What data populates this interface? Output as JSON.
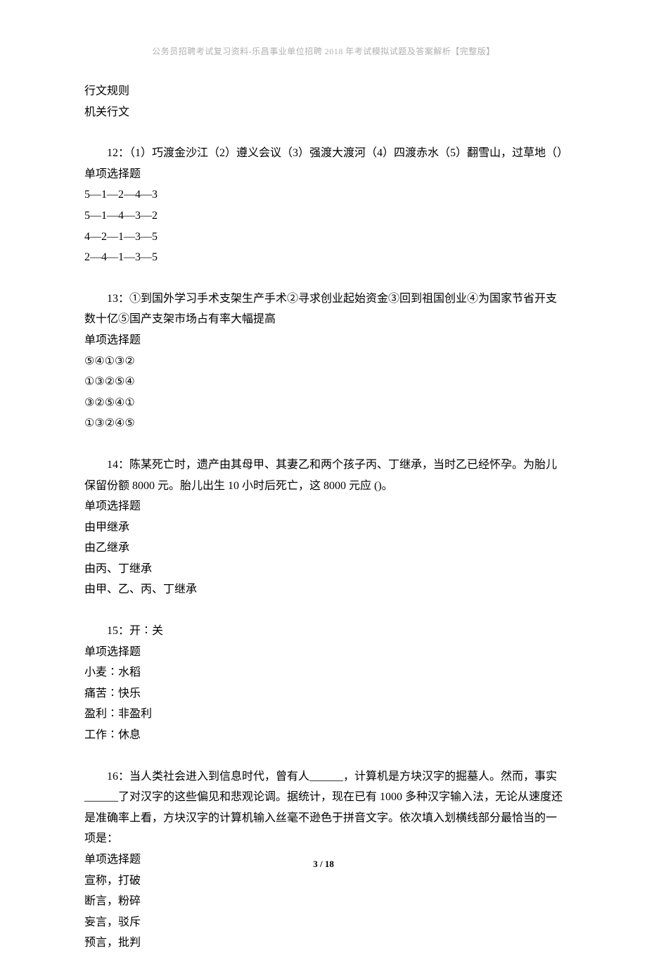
{
  "header": {
    "text": "公务员招聘考试复习资料-乐昌事业单位招聘 2018 年考试模拟试题及答案解析【完整版】"
  },
  "continuation": {
    "line1": "行文规则",
    "line2": "机关行文"
  },
  "q12": {
    "stem": "12：（1）巧渡金沙江（2）遵义会议（3）强渡大渡河（4）四渡赤水（5）翻雪山，过草地（）",
    "type": "单项选择题",
    "optA": "5—1—2—4—3",
    "optB": "5—1—4—3—2",
    "optC": "4—2—1—3—5",
    "optD": "2—4—1—3—5"
  },
  "q13": {
    "stem": "13：①到国外学习手术支架生产手术②寻求创业起始资金③回到祖国创业④为国家节省开支数十亿⑤国产支架市场占有率大幅提高",
    "type": "单项选择题",
    "optA": "⑤④①③②",
    "optB": "①③②⑤④",
    "optC": "③②⑤④①",
    "optD": "①③②④⑤"
  },
  "q14": {
    "stem": "14：陈某死亡时，遗产由其母甲、其妻乙和两个孩子丙、丁继承，当时乙已经怀孕。为胎儿保留份额 8000 元。胎儿出生 10 小时后死亡，这 8000 元应 ()。",
    "type": "单项选择题",
    "optA": "由甲继承",
    "optB": "由乙继承",
    "optC": "由丙、丁继承",
    "optD": "由甲、乙、丙、丁继承"
  },
  "q15": {
    "stem": "15：开∶关",
    "type": "单项选择题",
    "optA": "小麦∶水稻",
    "optB": "痛苦∶快乐",
    "optC": "盈利∶非盈利",
    "optD": "工作∶休息"
  },
  "q16": {
    "stem": "16：当人类社会进入到信息时代，曾有人______，计算机是方块汉字的掘墓人。然而，事实______了对汉字的这些偏见和悲观论调。据统计，现在已有 1000 多种汉字输入法，无论从速度还是准确率上看，方块汉字的计算机输入丝毫不逊色于拼音文字。依次填入划横线部分最恰当的一项是：",
    "type": "单项选择题",
    "optA": "宣称，打破",
    "optB": "断言，粉碎",
    "optC": "妄言，驳斥",
    "optD": "预言，批判"
  },
  "footer": {
    "current": "3",
    "sep": " / ",
    "total": "18"
  }
}
